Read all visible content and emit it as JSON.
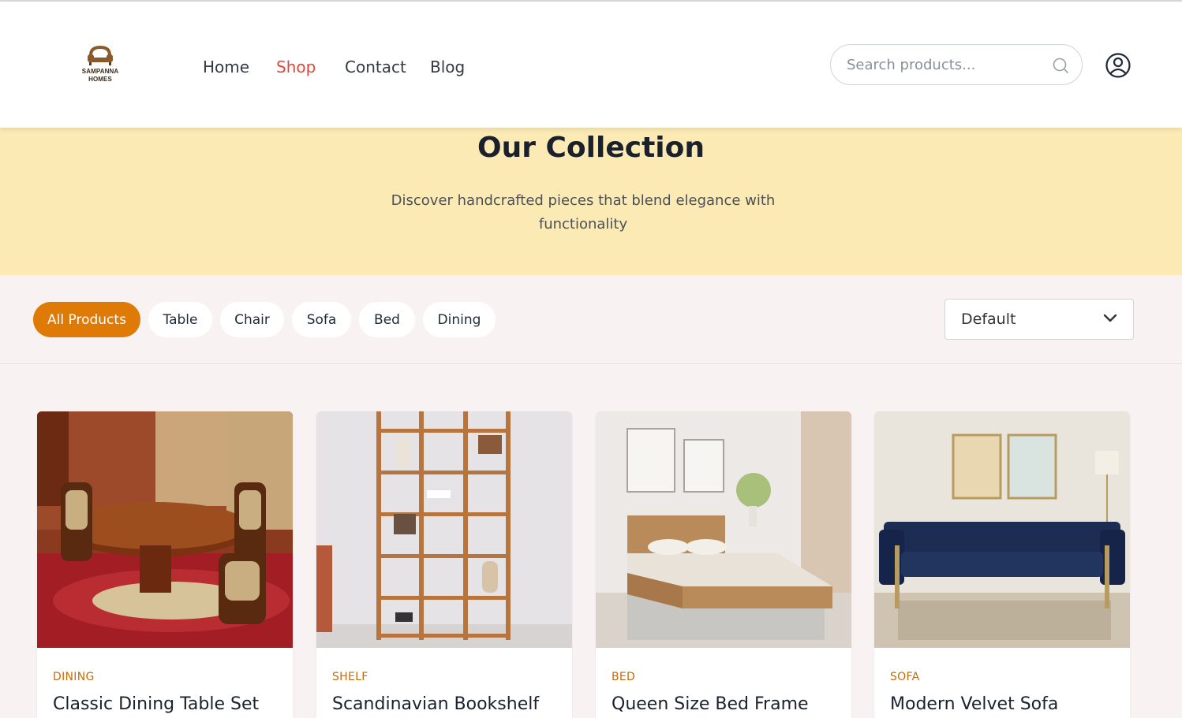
{
  "header": {
    "logo": {
      "line1": "SAMPANNA",
      "line2": "HOMES"
    },
    "nav": [
      {
        "label": "Home",
        "active": false
      },
      {
        "label": "Shop",
        "active": true
      },
      {
        "label": "Contact",
        "active": false
      },
      {
        "label": "Blog",
        "active": false
      }
    ],
    "search": {
      "placeholder": "Search products...",
      "value": "",
      "icon": "search-icon"
    },
    "user_icon": "user-icon"
  },
  "hero": {
    "title": "Our Collection",
    "subtitle": "Discover handcrafted pieces that blend elegance with functionality"
  },
  "filters": {
    "chips": [
      {
        "label": "All Products",
        "active": true
      },
      {
        "label": "Table",
        "active": false
      },
      {
        "label": "Chair",
        "active": false
      },
      {
        "label": "Sofa",
        "active": false
      },
      {
        "label": "Bed",
        "active": false
      },
      {
        "label": "Dining",
        "active": false
      }
    ],
    "sort": {
      "selected": "Default",
      "icon": "chevron-down-icon"
    }
  },
  "products": [
    {
      "category": "DINING",
      "name": "Classic Dining Table Set"
    },
    {
      "category": "SHELF",
      "name": "Scandinavian Bookshelf"
    },
    {
      "category": "BED",
      "name": "Queen Size Bed Frame"
    },
    {
      "category": "SOFA",
      "name": "Modern Velvet Sofa"
    }
  ],
  "colors": {
    "accent": "#df7a06",
    "active_nav": "#e0483f",
    "hero_bg": "#fbeab4",
    "page_bg": "#f8f2f2",
    "category_text": "#c96b0a"
  }
}
